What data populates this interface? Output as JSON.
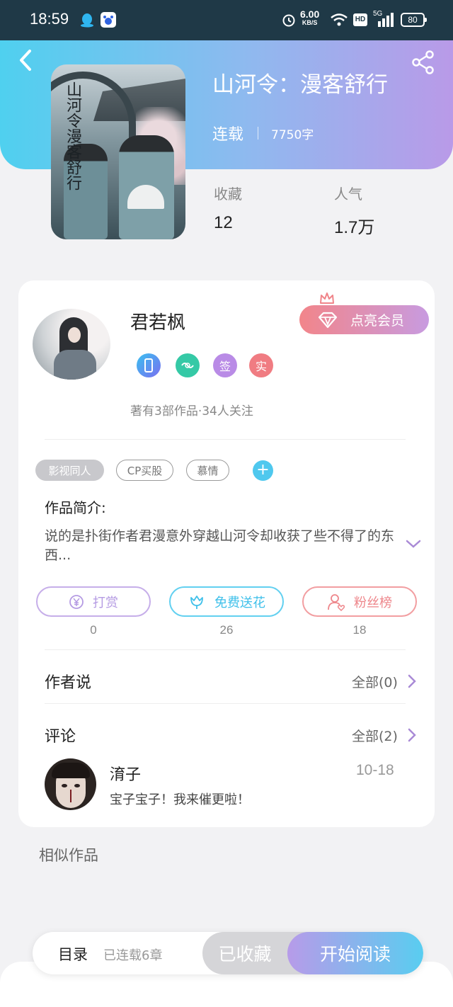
{
  "status_bar": {
    "time": "18:59",
    "net_speed": "6.00",
    "net_unit": "KB/S",
    "hd": "HD",
    "signal": "5G",
    "battery": "80"
  },
  "book": {
    "title": "山河令：漫客舒行",
    "status": "连载",
    "word_count": "7750字",
    "cover_text": "山河令漫客舒行"
  },
  "stats": {
    "favorites_label": "收藏",
    "favorites_value": "12",
    "popularity_label": "人气",
    "popularity_value": "1.7万"
  },
  "author": {
    "name": "君若枫",
    "vip_button": "点亮会员",
    "badges": [
      "签",
      "实"
    ],
    "works_info": "著有3部作品·34人关注"
  },
  "tags": [
    "影视同人",
    "CP买股",
    "慕情"
  ],
  "intro": {
    "title": "作品简介:",
    "text": "说的是扑街作者君漫意外穿越山河令却收获了些不得了的东西..."
  },
  "actions": [
    {
      "label": "打赏",
      "count": "0",
      "color": "#b9a0e0"
    },
    {
      "label": "免费送花",
      "count": "26",
      "color": "#4fc8ee"
    },
    {
      "label": "粉丝榜",
      "count": "18",
      "color": "#f08a8e"
    }
  ],
  "author_says": {
    "title": "作者说",
    "link": "全部(0)"
  },
  "comments": {
    "title": "评论",
    "link": "全部(2)",
    "items": [
      {
        "user": "淯子",
        "date": "10-18",
        "text": "宝子宝子！我来催更啦！"
      }
    ]
  },
  "similar_title": "相似作品",
  "bottom_bar": {
    "toc": "目录",
    "chapters": "已连载6章",
    "collected": "已收藏",
    "start_reading": "开始阅读"
  },
  "colors": {
    "hero_start": "#4fd0ef",
    "hero_end": "#b99ae8",
    "accent_purple": "#b79be9",
    "accent_blue": "#59cdf0"
  }
}
